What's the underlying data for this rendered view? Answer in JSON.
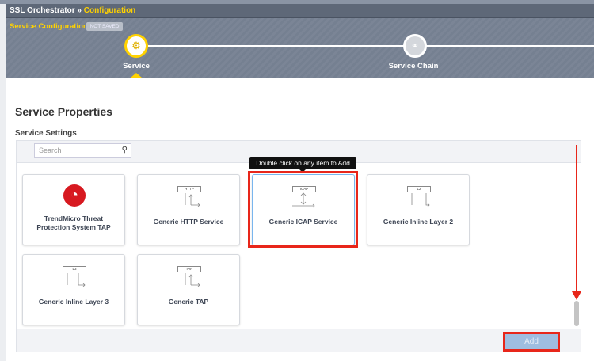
{
  "header": {
    "app": "SSL Orchestrator",
    "separator": "»",
    "section": "Configuration",
    "subtitle": "Service Configuration",
    "status_badge": "NOT SAVED"
  },
  "steps": [
    {
      "label": "Service",
      "active": true
    },
    {
      "label": "Service Chain",
      "active": false
    }
  ],
  "main": {
    "title": "Service Properties",
    "subtitle": "Service Settings",
    "search_placeholder": "Search",
    "tooltip": "Double click on any item to Add",
    "add_label": "Add"
  },
  "cards": [
    {
      "label": "TrendMicro Threat Protection System TAP"
    },
    {
      "label": "Generic HTTP Service",
      "tag": "HTTP"
    },
    {
      "label": "Generic ICAP Service",
      "tag": "ICAP"
    },
    {
      "label": "Generic Inline Layer 2",
      "tag": "L2"
    },
    {
      "label": "Generic Inline Layer 3",
      "tag": "L3"
    },
    {
      "label": "Generic TAP",
      "tag": "TAP"
    }
  ],
  "colors": {
    "accent": "#ffd200",
    "annotation": "#e8261a",
    "button": "#9fbde0"
  }
}
